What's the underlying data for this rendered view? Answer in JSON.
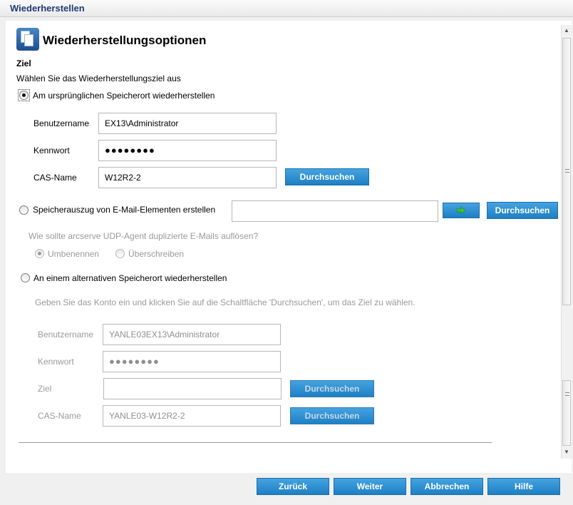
{
  "window": {
    "title": "Wiederherstellen"
  },
  "header": {
    "title": "Wiederherstellungsoptionen",
    "icon": "document-restore-icon"
  },
  "section": {
    "title": "Ziel",
    "subtitle": "Wählen Sie das Wiederherstellungsziel aus"
  },
  "option_original": {
    "label": "Am ursprünglichen Speicherort wiederherstellen",
    "selected": true,
    "username_label": "Benutzername",
    "username_value": "EX13\\Administrator",
    "password_label": "Kennwort",
    "password_value": "●●●●●●●●",
    "cas_label": "CAS-Name",
    "cas_value": "W12R2-2",
    "browse_label": "Durchsuchen"
  },
  "option_dump": {
    "label": "Speicherauszug von E-Mail-Elementen erstellen",
    "selected": false,
    "path_value": "",
    "go_icon": "green-arrow-icon",
    "browse_label": "Durchsuchen",
    "duplicate_question": "Wie sollte arcserve UDP-Agent duplizierte E-Mails auflösen?",
    "rename_label": "Umbenennen",
    "rename_selected": true,
    "overwrite_label": "Überschreiben",
    "overwrite_selected": false
  },
  "option_alternate": {
    "label": "An einem alternativen Speicherort wiederherstellen",
    "selected": false,
    "hint": "Geben Sie das Konto ein und klicken Sie auf die Schaltfläche 'Durchsuchen', um das Ziel zu wählen.",
    "username_label": "Benutzername",
    "username_value": "YANLE03EX13\\Administrator",
    "password_label": "Kennwort",
    "password_value": "●●●●●●●●",
    "target_label": "Ziel",
    "target_value": "",
    "target_browse_label": "Durchsuchen",
    "cas_label": "CAS-Name",
    "cas_value": "YANLE03-W12R2-2",
    "cas_browse_label": "Durchsuchen"
  },
  "footer": {
    "back_label": "Zurück",
    "next_label": "Weiter",
    "cancel_label": "Abbrechen",
    "help_label": "Hilfe"
  },
  "colors": {
    "button_blue": "#1d7fc4",
    "title_blue": "#1f3b73",
    "disabled_text": "#9a9a9a"
  }
}
